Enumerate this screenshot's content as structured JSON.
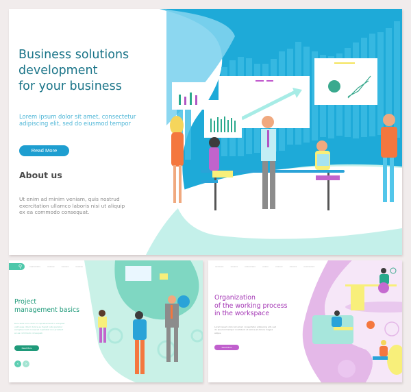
{
  "hero": {
    "title_lines": [
      "Business solutions",
      "development",
      "for your business"
    ],
    "subtitle_lines": [
      "Lorem ipsum dolor sit amet, consectetur",
      "adipiscing elit, sed do eiusmod tempor"
    ],
    "read_more_label": "Read More",
    "about_title": "About us",
    "about_text_lines": [
      "Ut enim ad minim veniam, quis nostrud",
      "exercitation ullamco laboris nisi ut aliquip",
      "ex ea  commodo consequat."
    ],
    "colors": {
      "title": "#1a7488",
      "subtitle": "#4cb5d6",
      "button": "#1e9ed0",
      "backdrop": "#1ea8d6",
      "wave": "#c4f0ea"
    }
  },
  "project_management": {
    "nav_items": [
      "xxxxxxxxx",
      "xxxxxx",
      "xxxxxx",
      "xxxxxx"
    ],
    "title_lines": [
      "Project",
      "management basics"
    ],
    "text_lines": [
      "Duis aute irure dolor in reprehenderit in voluptat",
      "velit esse cillum dolore eu fugiat nulla pariatur",
      "excepteur sint occaecat cupidatat non proident",
      "ex ea commodo consequat."
    ],
    "read_more_label": "Read More",
    "prev_icon": "‹",
    "next_icon": "›",
    "colors": {
      "accent": "#1f9a7a",
      "light": "#5dceb2",
      "blob": "#8ee0cc"
    }
  },
  "organization": {
    "nav_items": [
      "xxxxxxx",
      "xxxxxx",
      "xxxxxxxxx",
      "xxxxx",
      "xxxxxx",
      "xxxxxx",
      "xxxxxxxxx"
    ],
    "title_lines": [
      "Organization",
      "of the working process",
      "in the workspace"
    ],
    "text_lines": [
      "Lorem ipsum dolor sit amet, consectetur adipiscing elit, sed",
      "do eiusmod tempor incididunt ut labore et dolore magna",
      "aliqua."
    ],
    "read_more_label": "Read More",
    "colors": {
      "accent": "#a437b5",
      "button": "#c05fcd",
      "blob": "#e4b8e8"
    }
  }
}
